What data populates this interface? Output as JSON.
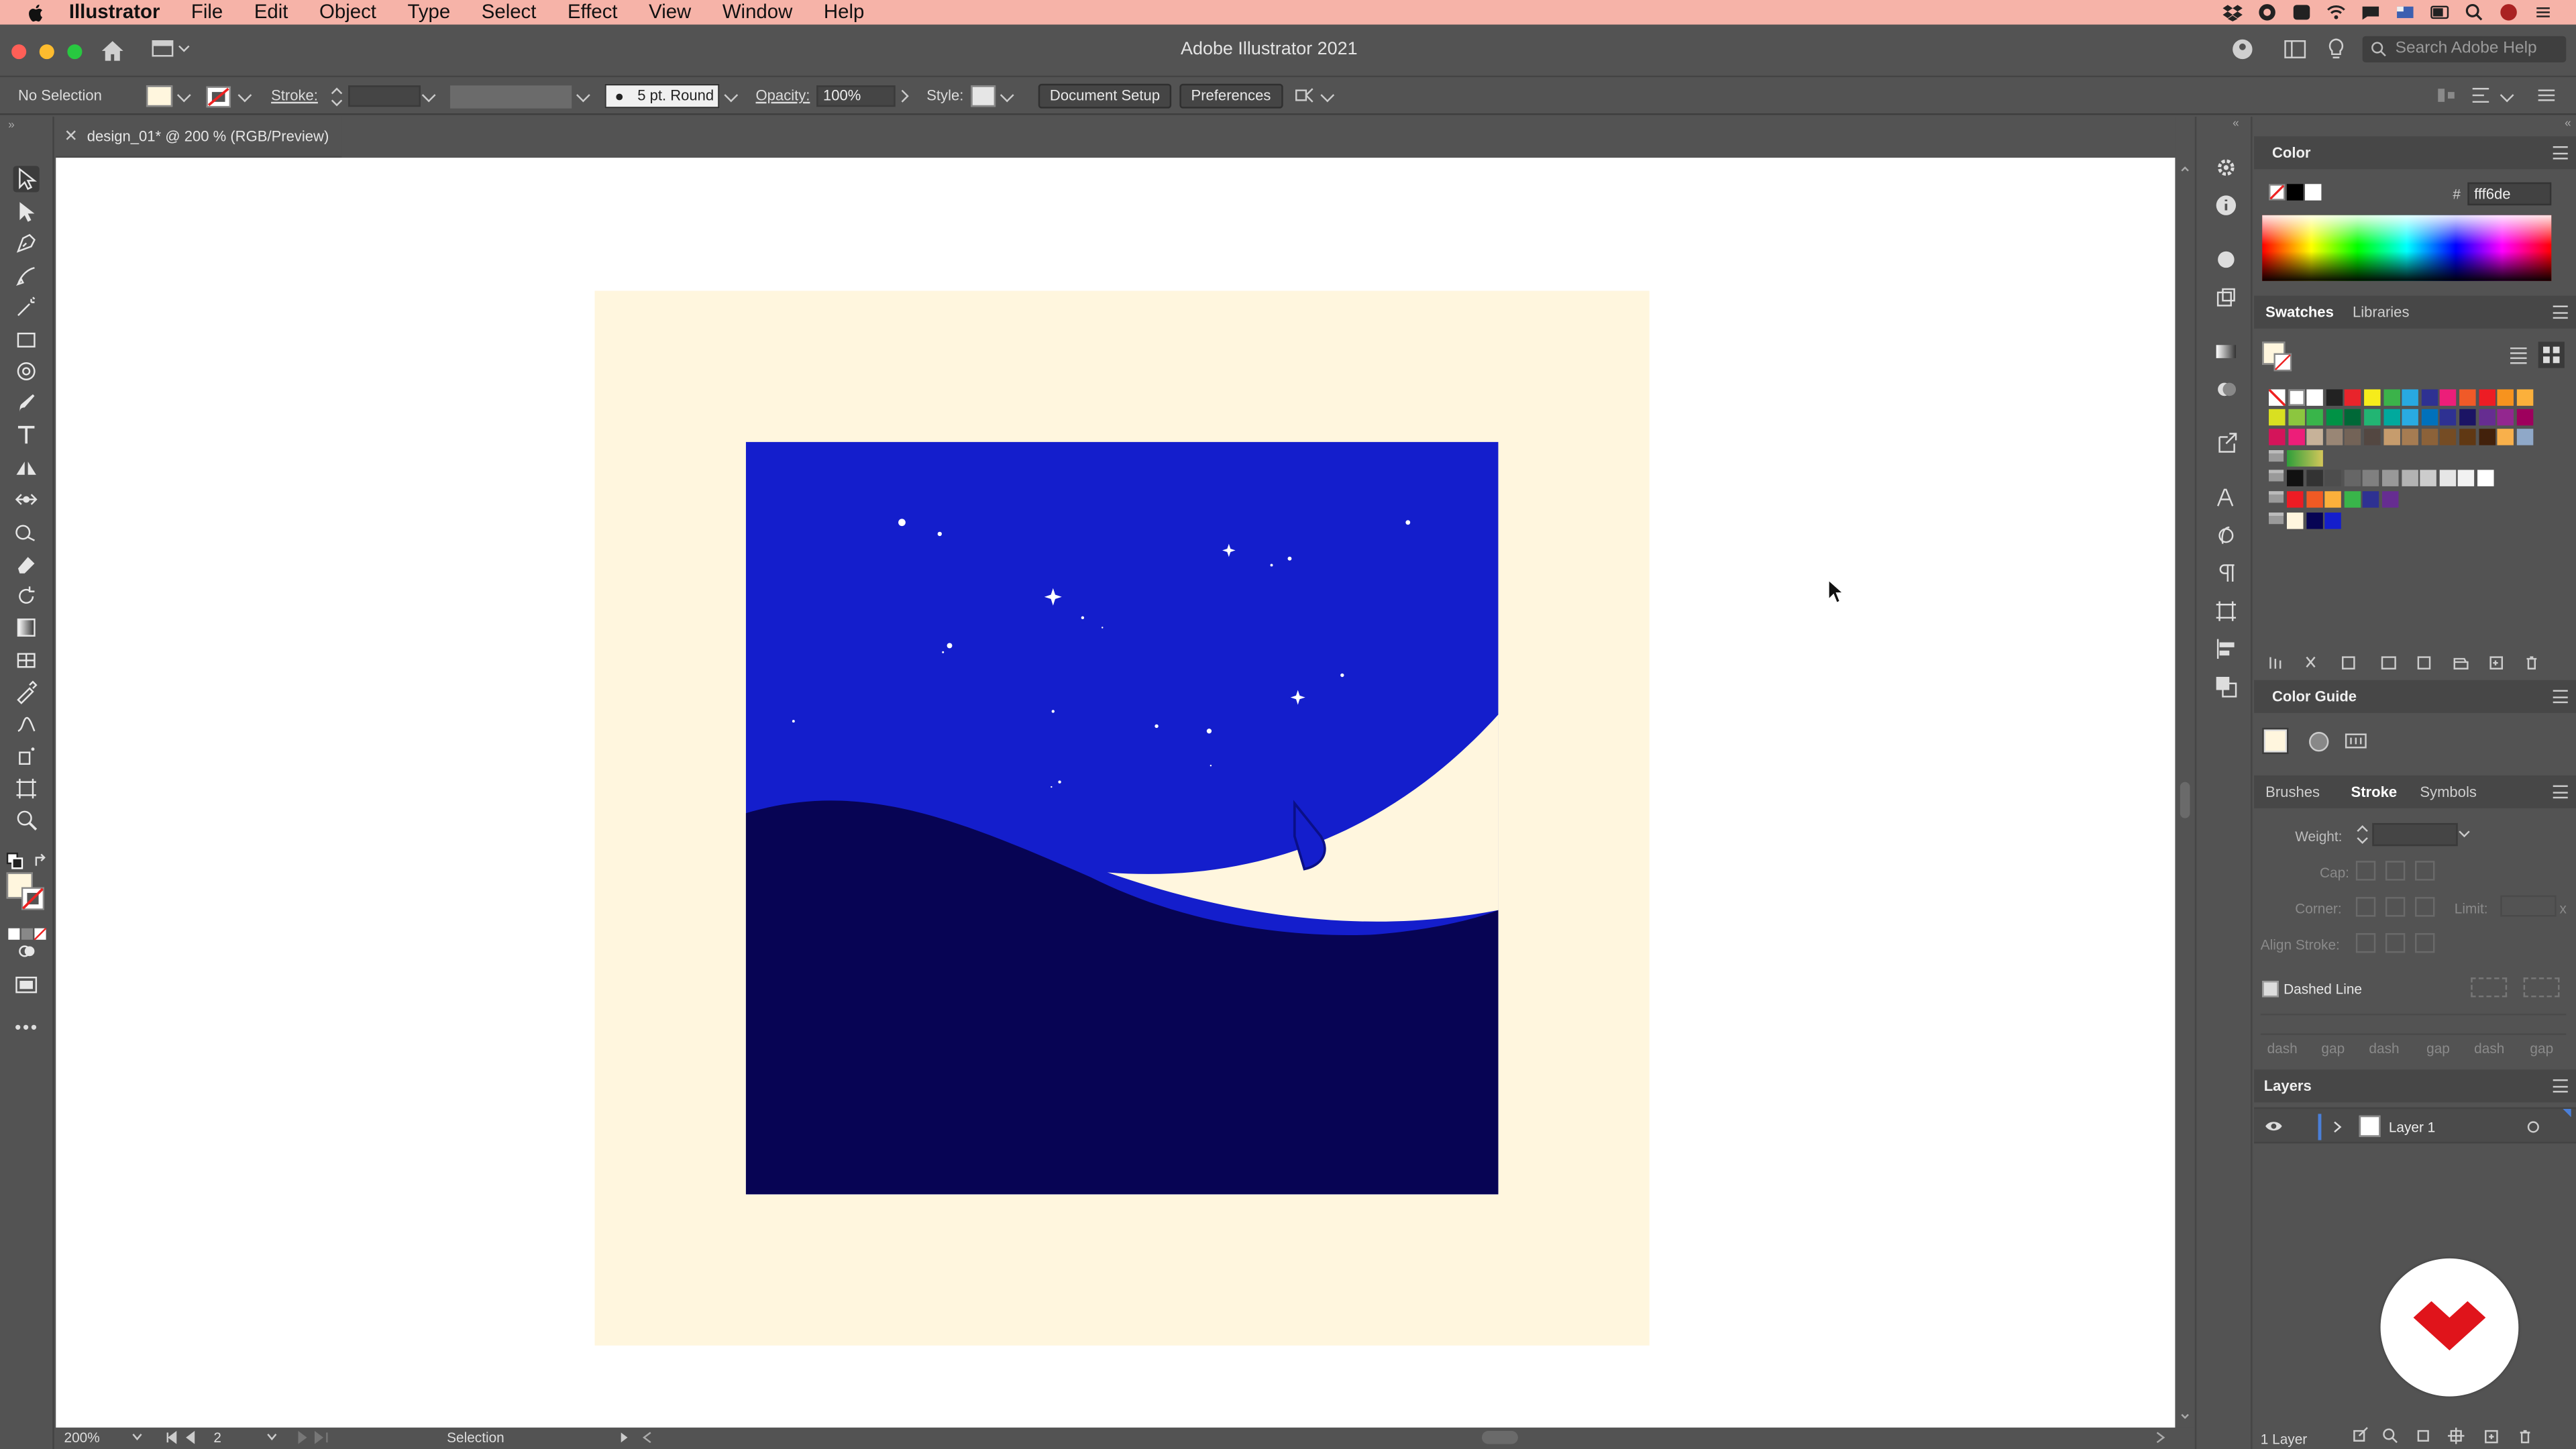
{
  "menubar": {
    "items": [
      "Illustrator",
      "File",
      "Edit",
      "Object",
      "Type",
      "Select",
      "Effect",
      "View",
      "Window",
      "Help"
    ]
  },
  "app": {
    "title": "Adobe Illustrator 2021",
    "search_placeholder": "Search Adobe Help"
  },
  "control_bar": {
    "selection": "No Selection",
    "stroke_label": "Stroke:",
    "brush": "5 pt. Round",
    "opacity_label": "Opacity:",
    "opacity_value": "100%",
    "style_label": "Style:",
    "document_setup": "Document Setup",
    "preferences": "Preferences"
  },
  "document": {
    "tab": "design_01* @ 200 % (RGB/Preview)"
  },
  "status_bar": {
    "zoom": "200%",
    "artboard": "2",
    "tool": "Selection"
  },
  "panels": {
    "color": {
      "title": "Color",
      "hex_symbol": "#",
      "hex": "fff6de"
    },
    "swatches": {
      "tabs": [
        "Swatches",
        "Libraries"
      ]
    },
    "color_guide": {
      "title": "Color Guide"
    },
    "stroke": {
      "tabs": [
        "Brushes",
        "Stroke",
        "Symbols"
      ],
      "weight": "Weight:",
      "cap": "Cap:",
      "corner": "Corner:",
      "limit": "Limit:",
      "limit_x": "x",
      "align": "Align Stroke:",
      "dashed": "Dashed Line",
      "dash_labels": [
        "dash",
        "gap",
        "dash",
        "gap",
        "dash",
        "gap"
      ]
    },
    "layers": {
      "title": "Layers",
      "layer_name": "Layer 1",
      "footer": "1 Layer"
    }
  },
  "colors": {
    "menubar": "#f6b3a8",
    "ui_bg": "#535353",
    "artboard_bg": "#fff6de",
    "sky": "#141ecc",
    "hill": "#070454",
    "layer_accent": "#4a7fd8",
    "logo_red": "#e0141b"
  },
  "icons": [
    "apple-icon",
    "home-icon",
    "workspace-icon",
    "search-icon",
    "dropbox-icon",
    "wifi-icon",
    "selection-tool-icon",
    "direct-selection-tool-icon",
    "pen-tool-icon",
    "type-tool-icon",
    "zoom-tool-icon",
    "eye-icon",
    "panel-menu-icon",
    "cursor-icon"
  ]
}
